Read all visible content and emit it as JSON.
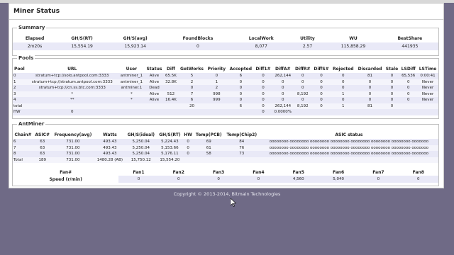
{
  "page_title": "Miner Status",
  "summary": {
    "legend": "Summary",
    "headers": [
      "Elapsed",
      "GH/S(RT)",
      "GH/S(avg)",
      "FoundBlocks",
      "LocalWork",
      "Utility",
      "WU",
      "BestShare"
    ],
    "row": [
      "2m20s",
      "15,554.19",
      "15,923.14",
      "0",
      "8,077",
      "2.57",
      "115,858.29",
      "441935"
    ]
  },
  "pools": {
    "legend": "Pools",
    "headers": [
      "Pool",
      "URL",
      "User",
      "Status",
      "Diff",
      "GetWorks",
      "Priority",
      "Accepted",
      "Diff1#",
      "DiffA#",
      "DiffR#",
      "DiffS#",
      "Rejected",
      "Discarded",
      "Stale",
      "LSDiff",
      "LSTime"
    ],
    "rows": [
      [
        "0",
        "stratum+tcp://solo.antpool.com:3333",
        "antminer_1",
        "Alive",
        "65.5K",
        "5",
        "0",
        "6",
        "0",
        "262,144",
        "0",
        "0",
        "0",
        "81",
        "0",
        "65,536",
        "0:00:41"
      ],
      [
        "1",
        "stratum+tcp://stratum.antpool.com:3333",
        "antminer_1",
        "Alive",
        "32.8K",
        "2",
        "1",
        "0",
        "0",
        "0",
        "0",
        "0",
        "0",
        "0",
        "0",
        "0",
        "Never"
      ],
      [
        "2",
        "stratum+tcp://cn.ss.btc.com:3333",
        "antminer.1",
        "Dead",
        "",
        "0",
        "2",
        "0",
        "0",
        "0",
        "0",
        "0",
        "0",
        "0",
        "0",
        "0",
        "Never"
      ],
      [
        "3",
        "*",
        "*",
        "Alive",
        "512",
        "7",
        "998",
        "0",
        "0",
        "0",
        "8,192",
        "0",
        "1",
        "0",
        "0",
        "0",
        "Never"
      ],
      [
        "4",
        "**",
        "*",
        "Alive",
        "16.4K",
        "6",
        "999",
        "0",
        "0",
        "0",
        "0",
        "0",
        "0",
        "0",
        "0",
        "0",
        "Never"
      ],
      [
        "total",
        "",
        "",
        "",
        "",
        "20",
        "",
        "6",
        "0",
        "262,144",
        "8,192",
        "0",
        "1",
        "81",
        "0",
        "",
        ""
      ],
      [
        "HW",
        "0",
        "",
        "",
        "",
        "",
        "",
        "",
        "0",
        "0.0000%",
        "",
        "",
        "",
        "",
        "",
        "",
        ""
      ]
    ]
  },
  "antminer": {
    "legend": "AntMiner",
    "headers": [
      "Chain#",
      "ASIC#",
      "Frequency(avg)",
      "Watts",
      "GH/S(ideal)",
      "GH/S(RT)",
      "HW",
      "Temp(PCB)",
      "Temp(Chip2)",
      "ASIC status"
    ],
    "rows": [
      [
        "6",
        "63",
        "731.00",
        "493.43",
        "5,250.04",
        "5,224.43",
        "0",
        "69",
        "84",
        "oooooooo oooooooo oooooooo oooooooo oooooooo oooooooo oooooooo ooooooo"
      ],
      [
        "7",
        "63",
        "731.00",
        "493.43",
        "5,250.04",
        "5,153.66",
        "0",
        "61",
        "76",
        "oooooooo oooooooo oooooooo oooooooo oooooooo oooooooo oooooooo ooooooo"
      ],
      [
        "8",
        "63",
        "731.00",
        "493.43",
        "5,250.04",
        "5,176.11",
        "0",
        "58",
        "73",
        "oooooooo oooooooo oooooooo oooooooo oooooooo oooooooo oooooooo ooooooo"
      ],
      [
        "Total",
        "189",
        "731.00",
        "1480.28 (AB)",
        "15,750.12",
        "15,554.20",
        "",
        "",
        "",
        ""
      ]
    ],
    "fan_headers": [
      "Fan#",
      "Fan1",
      "Fan2",
      "Fan3",
      "Fan4",
      "Fan5",
      "Fan6",
      "Fan7",
      "Fan8"
    ],
    "fan_row": [
      "Speed (r/min)",
      "0",
      "0",
      "0",
      "0",
      "4,560",
      "5,040",
      "0",
      "0"
    ]
  },
  "footer": "Copyright © 2013-2014, Bitmain Technologies",
  "colors": {
    "background": "#6f6a86",
    "row_tint": "#e9e9f7"
  }
}
